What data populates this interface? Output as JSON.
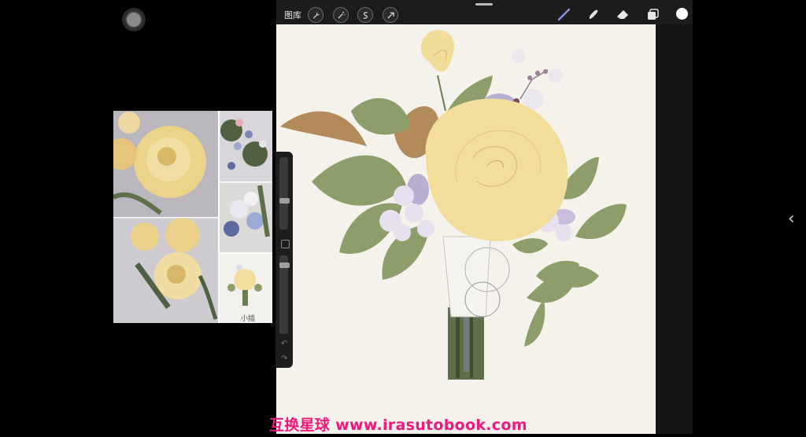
{
  "toolbar": {
    "gallery_label": "图库",
    "left_tools": [
      "wrench-icon",
      "magic-wand-icon",
      "selection-icon",
      "transform-arrow-icon"
    ],
    "right_tools": [
      "brush-icon",
      "smudge-icon",
      "eraser-icon",
      "layers-icon"
    ],
    "color": "#ffffff"
  },
  "reference": {
    "thumb_label": "小插"
  },
  "watermark": {
    "text": "互换星球 www.irasutobook.com",
    "color": "#f0197d"
  },
  "colors": {
    "canvas": "#f4f2ea",
    "leaf": "#8e9e6a",
    "rose": "#f3dd9a",
    "berry": "#e6e0ef",
    "stem": "#5e6f4a"
  }
}
